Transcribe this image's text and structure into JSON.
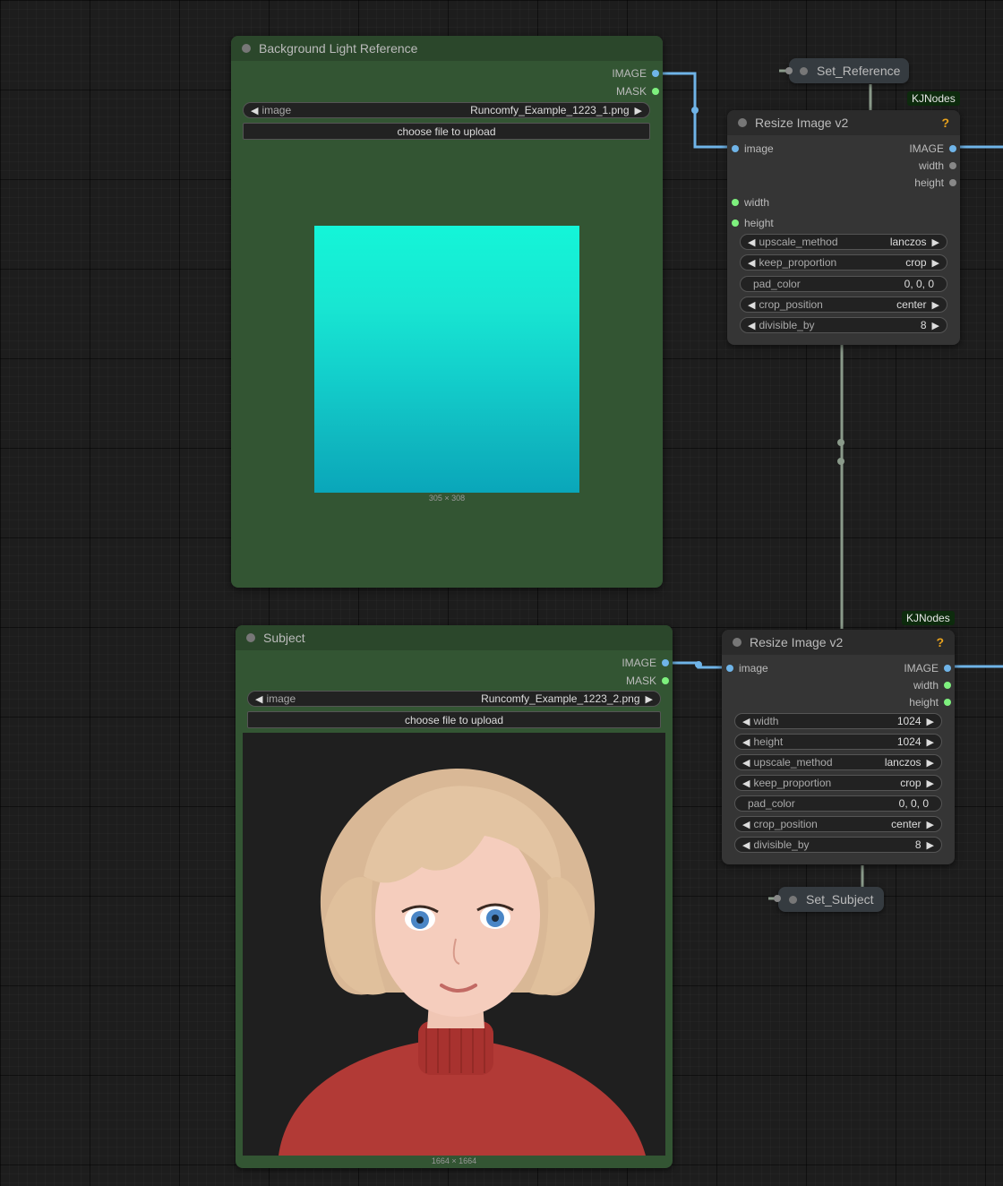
{
  "nodes": {
    "bg_ref": {
      "title": "Background Light Reference",
      "outputs": [
        "IMAGE",
        "MASK"
      ],
      "image_widget": {
        "label": "image",
        "value": "Runcomfy_Example_1223_1.png"
      },
      "upload_label": "choose file to upload",
      "preview_dims": "305 × 308"
    },
    "subject": {
      "title": "Subject",
      "outputs": [
        "IMAGE",
        "MASK"
      ],
      "image_widget": {
        "label": "image",
        "value": "Runcomfy_Example_1223_2.png"
      },
      "upload_label": "choose file to upload",
      "preview_dims": "1664 × 1664"
    },
    "resize_top": {
      "badge": "KJNodes",
      "title": "Resize Image v2",
      "help": "?",
      "inputs": [
        "image",
        "width",
        "height"
      ],
      "outputs": [
        "IMAGE",
        "width",
        "height"
      ],
      "widgets": [
        {
          "label": "upscale_method",
          "value": "lanczos"
        },
        {
          "label": "keep_proportion",
          "value": "crop"
        },
        {
          "label": "pad_color",
          "value": "0, 0, 0"
        },
        {
          "label": "crop_position",
          "value": "center"
        },
        {
          "label": "divisible_by",
          "value": "8"
        }
      ]
    },
    "resize_bottom": {
      "badge": "KJNodes",
      "title": "Resize Image v2",
      "help": "?",
      "inputs": [
        "image"
      ],
      "outputs": [
        "IMAGE",
        "width",
        "height"
      ],
      "widgets": [
        {
          "label": "width",
          "value": "1024"
        },
        {
          "label": "height",
          "value": "1024"
        },
        {
          "label": "upscale_method",
          "value": "lanczos"
        },
        {
          "label": "keep_proportion",
          "value": "crop"
        },
        {
          "label": "pad_color",
          "value": "0, 0, 0"
        },
        {
          "label": "crop_position",
          "value": "center"
        },
        {
          "label": "divisible_by",
          "value": "8"
        }
      ]
    },
    "set_reference": {
      "title": "Set_Reference"
    },
    "set_subject": {
      "title": "Set_Subject"
    }
  },
  "colors": {
    "canvas": "#1d1d1d",
    "load_node_body": "#335533",
    "resize_node_body": "#353535",
    "image_link": "#6fb4e8",
    "int_link": "#7ef07e",
    "help_icon": "#e8a21c",
    "badge_bg": "#0d2b0d"
  }
}
